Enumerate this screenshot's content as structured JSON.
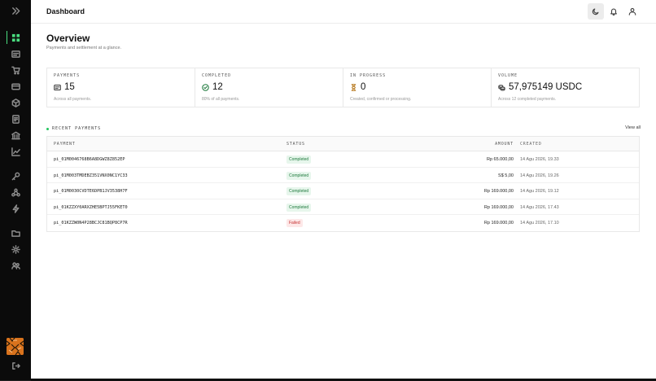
{
  "header": {
    "title": "Dashboard"
  },
  "overview": {
    "title": "Overview",
    "subtitle": "Payments and settlement at a glance."
  },
  "stats": [
    {
      "label": "PAYMENTS",
      "value": "15",
      "note": "Across all payments.",
      "icon": "card-icon"
    },
    {
      "label": "COMPLETED",
      "value": "12",
      "note": "80% of all payments.",
      "icon": "check-circle-icon"
    },
    {
      "label": "IN PROGRESS",
      "value": "0",
      "note": "Created, confirmed or processing.",
      "icon": "hourglass-icon"
    },
    {
      "label": "VOLUME",
      "value": "57,975149 USDC",
      "note": "Across 12 completed payments.",
      "icon": "coins-icon"
    }
  ],
  "recent": {
    "title": "RECENT PAYMENTS",
    "view_all": "View all",
    "columns": {
      "payment": "PAYMENT",
      "status": "STATUS",
      "amount": "AMOUNT",
      "created": "CREATED"
    },
    "rows": [
      {
        "id": "pi_01M0046768B6A8DGWZ8Z852EP",
        "status": "Completed",
        "amount": "Rp 65.000,00",
        "created": "14 Agu 2026, 19.33"
      },
      {
        "id": "pi_01M003TMDEBZ351VNX0NC1YC33",
        "status": "Completed",
        "amount": "S$ 5,00",
        "created": "14 Agu 2026, 19.26"
      },
      {
        "id": "pi_01M0030CVDTE6DPB1JV3538H7F",
        "status": "Completed",
        "amount": "Rp 169.000,00",
        "created": "14 Agu 2026, 19.12"
      },
      {
        "id": "pi_01KZZXY0ARXZHE5BPTJ55FKET0",
        "status": "Completed",
        "amount": "Rp 169.000,00",
        "created": "14 Agu 2026, 17.43"
      },
      {
        "id": "pi_01KZZW0N4P28BCJC81BQP8CP7R",
        "status": "Failed",
        "amount": "Rp 169.000,00",
        "created": "14 Agu 2026, 17.10"
      }
    ]
  },
  "colors": {
    "accent": "#4ade80",
    "success": "#1f7a3d",
    "danger": "#c53030",
    "sidebar": "#0b0b0b",
    "avatar": "#d9731d"
  }
}
